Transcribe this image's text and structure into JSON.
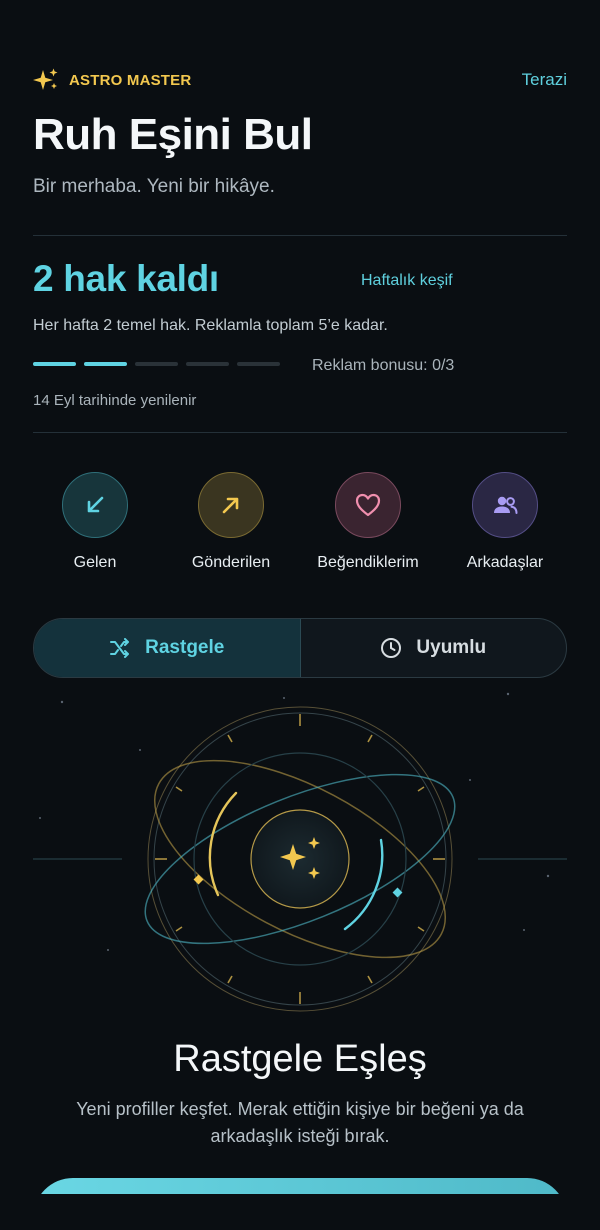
{
  "header": {
    "brand_label": "ASTRO MASTER",
    "sign_link": "Terazi",
    "title": "Ruh Eşini Bul",
    "subtitle": "Bir merhaba. Yeni bir hikâye."
  },
  "credits": {
    "remaining_text": "2 hak kaldı",
    "weekly_link": "Haftalık keşif",
    "description": "Her hafta 2 temel hak. Reklamla toplam 5’e kadar.",
    "progress_filled": 2,
    "progress_total": 5,
    "bonus_text": "Reklam bonusu: 0/3",
    "renew_text": "14 Eyl tarihinde yenilenir"
  },
  "quick_actions": [
    {
      "label": "Gelen",
      "icon": "arrow-down-left-icon",
      "color": "#5fd3e2"
    },
    {
      "label": "Gönderilen",
      "icon": "arrow-up-right-icon",
      "color": "#f3c84f"
    },
    {
      "label": "Beğendiklerim",
      "icon": "heart-icon",
      "color": "#f08fae"
    },
    {
      "label": "Arkadaşlar",
      "icon": "users-icon",
      "color": "#a99cf3"
    }
  ],
  "mode_tabs": {
    "random": {
      "label": "Rastgele",
      "icon": "shuffle-icon",
      "active": true
    },
    "compatible": {
      "label": "Uyumlu",
      "icon": "clock-icon",
      "active": false
    }
  },
  "match": {
    "title": "Rastgele Eşleş",
    "description": "Yeni profiller keşfet. Merak ettiğin kişiye bir beğeni ya da arkadaşlık isteği bırak."
  },
  "colors": {
    "accent": "#5fd3e2",
    "gold": "#f3c84f",
    "background": "#0a0e12"
  }
}
